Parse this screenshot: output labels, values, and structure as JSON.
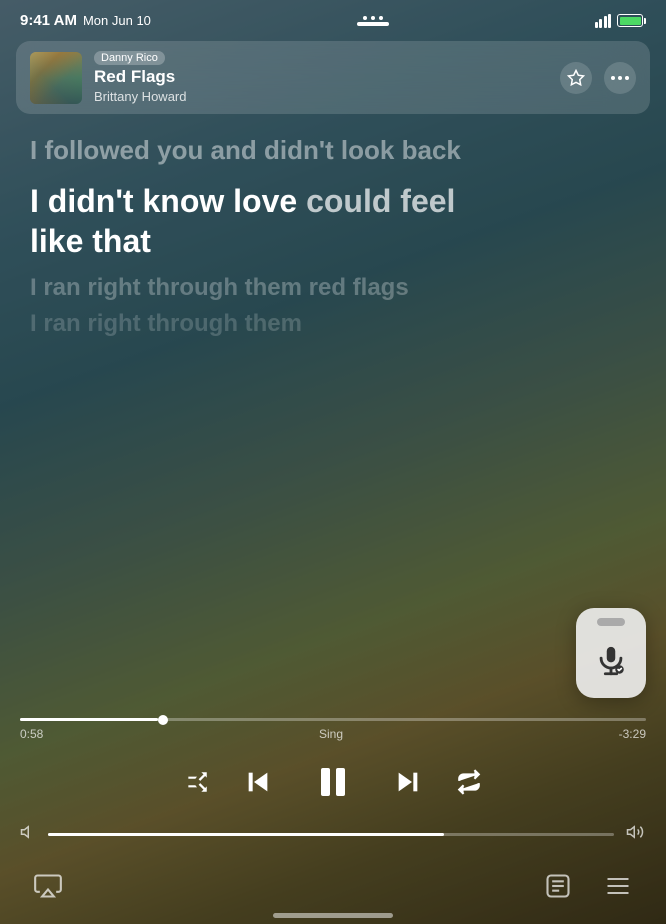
{
  "statusBar": {
    "time": "9:41 AM",
    "date": "Mon Jun 10",
    "wifi": "100%"
  },
  "nowPlaying": {
    "user": "Danny Rico",
    "title": "Red Flags",
    "artist": "Brittany Howard",
    "starLabel": "star",
    "moreLabel": "more"
  },
  "lyrics": {
    "prev": "I followed you and didn't look back",
    "active_1": "I didn't know love ",
    "active_2": "could feel",
    "active_3": "like that",
    "next_1": "I ran right through them red flags",
    "next_2": "I ran right through them"
  },
  "progress": {
    "current": "0:58",
    "label": "Sing",
    "remaining": "-3:29",
    "percent": 22
  },
  "controls": {
    "shuffle": "shuffle",
    "rewind": "rewind",
    "pause": "pause",
    "fastForward": "fast forward",
    "repeat": "repeat"
  },
  "volume": {
    "low": "volume low",
    "high": "volume high",
    "percent": 70
  },
  "bottomBar": {
    "airplay": "AirPlay",
    "lyrics": "lyrics",
    "queue": "queue"
  }
}
